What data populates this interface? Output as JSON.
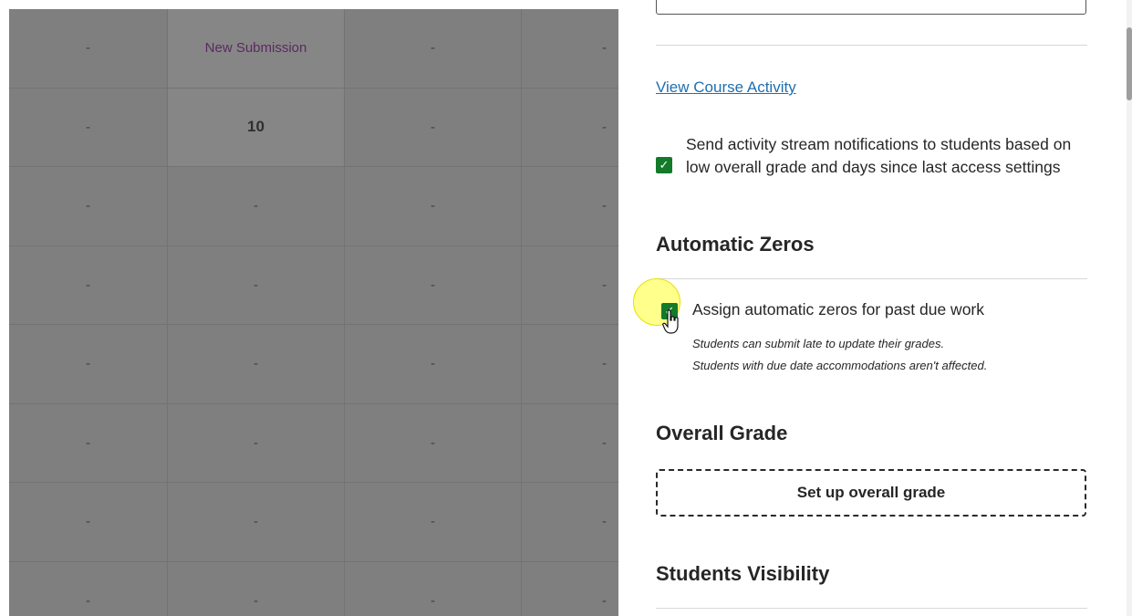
{
  "grid": {
    "rows": [
      [
        "-",
        "New Submission",
        "-",
        "-"
      ],
      [
        "-",
        "10",
        "-",
        "-"
      ],
      [
        "-",
        "-",
        "-",
        "-"
      ],
      [
        "-",
        "-",
        "-",
        "-"
      ],
      [
        "-",
        "-",
        "-",
        "-"
      ],
      [
        "-",
        "-",
        "-",
        "-"
      ],
      [
        "-",
        "-",
        "-",
        "-"
      ],
      [
        "-",
        "-",
        "-",
        "-"
      ]
    ]
  },
  "panel": {
    "view_activity_link": "View Course Activity",
    "notify_checkbox": {
      "checked": true,
      "label": "Send activity stream notifications to students based on low overall grade and days since last access settings"
    },
    "automatic_zeros": {
      "title": "Automatic Zeros",
      "checkbox_checked": true,
      "label": "Assign automatic zeros for past due work",
      "help_line1": "Students can submit late to update their grades.",
      "help_line2": "Students with due date accommodations aren't affected."
    },
    "overall_grade": {
      "title": "Overall Grade",
      "setup_button": "Set up overall grade"
    },
    "students_visibility": {
      "title": "Students Visibility"
    }
  },
  "colors": {
    "checkbox": "#137a2a",
    "link": "#1f6fb0",
    "overlay": "#7f7f7f",
    "cursor_halo": "#ffff78"
  }
}
